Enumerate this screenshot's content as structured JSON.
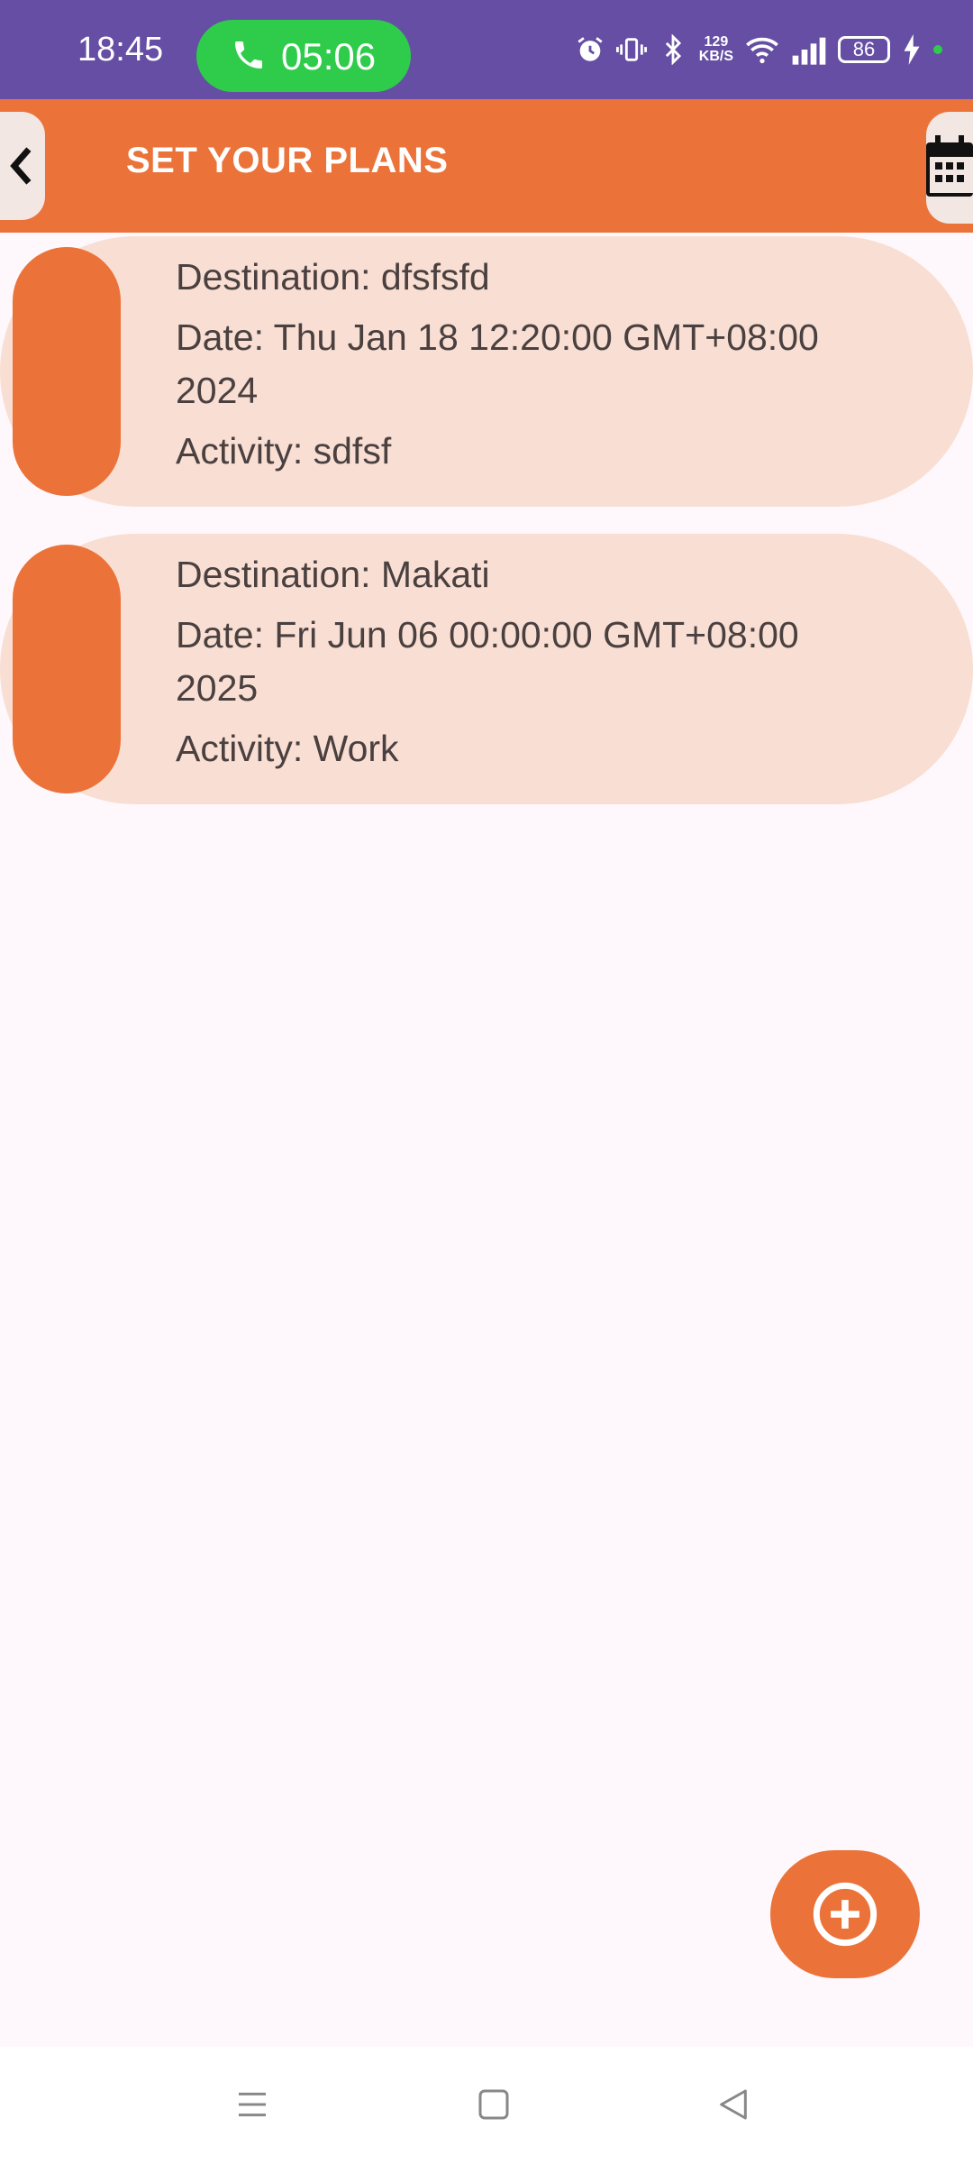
{
  "status_bar": {
    "time": "18:45",
    "call_duration": "05:06",
    "net_speed_value": "129",
    "net_speed_unit": "KB/S",
    "battery_level": "86",
    "icons": [
      "alarm-icon",
      "vibrate-icon",
      "bluetooth-icon",
      "wifi-icon",
      "signal-icon",
      "battery-icon",
      "charging-icon"
    ]
  },
  "app_bar": {
    "title": "SET YOUR PLANS",
    "back_icon": "chevron-left-icon",
    "calendar_icon": "calendar-icon"
  },
  "plans": [
    {
      "destination": "Destination: dfsfsfd",
      "date": "Date: Thu Jan 18 12:20:00 GMT+08:00 2024",
      "activity": "Activity: sdfsf"
    },
    {
      "destination": "Destination: Makati",
      "date": "Date: Fri Jun 06 00:00:00 GMT+08:00 2025",
      "activity": "Activity: Work"
    }
  ],
  "fab": {
    "icon": "add-circle-icon"
  },
  "nav_bar": {
    "icons": [
      "menu-icon",
      "home-icon",
      "back-icon"
    ]
  },
  "colors": {
    "status_bar": "#654EA3",
    "accent": "#EB7339",
    "card": "#F9DFD3",
    "call_pill": "#2ECC4A",
    "background": "#FEF8FC"
  }
}
